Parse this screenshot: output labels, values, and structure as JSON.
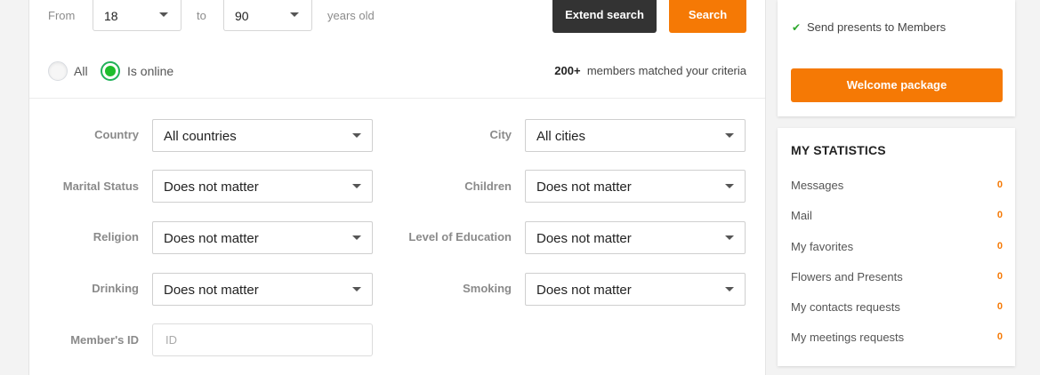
{
  "age_filter": {
    "from_label": "From",
    "from_value": "18",
    "to_label": "to",
    "to_value": "90",
    "suffix": "years old"
  },
  "buttons": {
    "extend_search": "Extend search",
    "search": "Search"
  },
  "online_filter": {
    "all_label": "All",
    "online_label": "Is online",
    "selected": "Is online"
  },
  "results": {
    "count": "200+",
    "text": "members matched your criteria"
  },
  "fields": {
    "country": {
      "label": "Country",
      "value": "All countries"
    },
    "city": {
      "label": "City",
      "value": "All cities"
    },
    "marital_status": {
      "label": "Marital Status",
      "value": "Does not matter"
    },
    "children": {
      "label": "Children",
      "value": "Does not matter"
    },
    "religion": {
      "label": "Religion",
      "value": "Does not matter"
    },
    "education": {
      "label": "Level of Education",
      "value": "Does not matter"
    },
    "drinking": {
      "label": "Drinking",
      "value": "Does not matter"
    },
    "smoking": {
      "label": "Smoking",
      "value": "Does not matter"
    },
    "member_id": {
      "label": "Member's ID",
      "placeholder": "ID"
    }
  },
  "promo": {
    "feature": "Send presents to Members",
    "button": "Welcome package"
  },
  "statistics": {
    "title": "MY STATISTICS",
    "items": [
      {
        "label": "Messages",
        "count": "0"
      },
      {
        "label": "Mail",
        "count": "0"
      },
      {
        "label": "My favorites",
        "count": "0"
      },
      {
        "label": "Flowers and Presents",
        "count": "0"
      },
      {
        "label": "My contacts requests",
        "count": "0"
      },
      {
        "label": "My meetings requests",
        "count": "0"
      }
    ]
  },
  "colors": {
    "accent": "#f57905",
    "dark_button": "#333333",
    "online_green": "#1ebd2c"
  }
}
